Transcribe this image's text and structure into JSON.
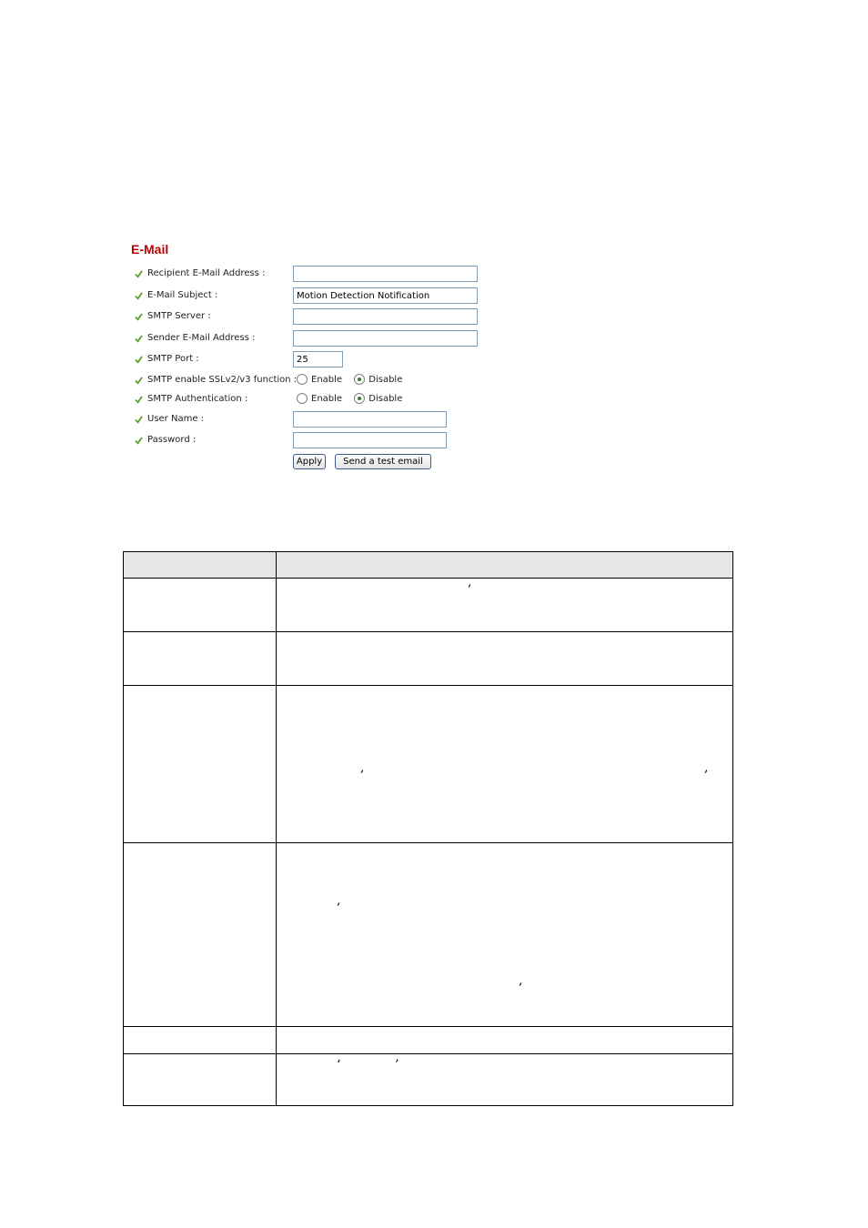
{
  "panel": {
    "title": "E-Mail",
    "fields": {
      "recipient": {
        "label": "Recipient E-Mail Address :",
        "value": ""
      },
      "subject": {
        "label": "E-Mail Subject :",
        "value": "Motion Detection Notification"
      },
      "smtp_server": {
        "label": "SMTP Server :",
        "value": ""
      },
      "sender": {
        "label": "Sender E-Mail Address :",
        "value": ""
      },
      "smtp_port": {
        "label": "SMTP Port :",
        "value": "25"
      },
      "ssl": {
        "label": "SMTP enable SSLv2/v3 function :",
        "enable": "Enable",
        "disable": "Disable",
        "selected": "Disable"
      },
      "auth": {
        "label": "SMTP Authentication :",
        "enable": "Enable",
        "disable": "Disable",
        "selected": "Disable"
      },
      "username": {
        "label": "User Name :",
        "value": ""
      },
      "password": {
        "label": "Password :",
        "value": ""
      }
    },
    "buttons": {
      "apply": "Apply",
      "test": "Send a test email"
    }
  },
  "table": {
    "punctuation": {
      "comma": ",",
      "open_quote": "‘",
      "close_quote": "’"
    }
  }
}
